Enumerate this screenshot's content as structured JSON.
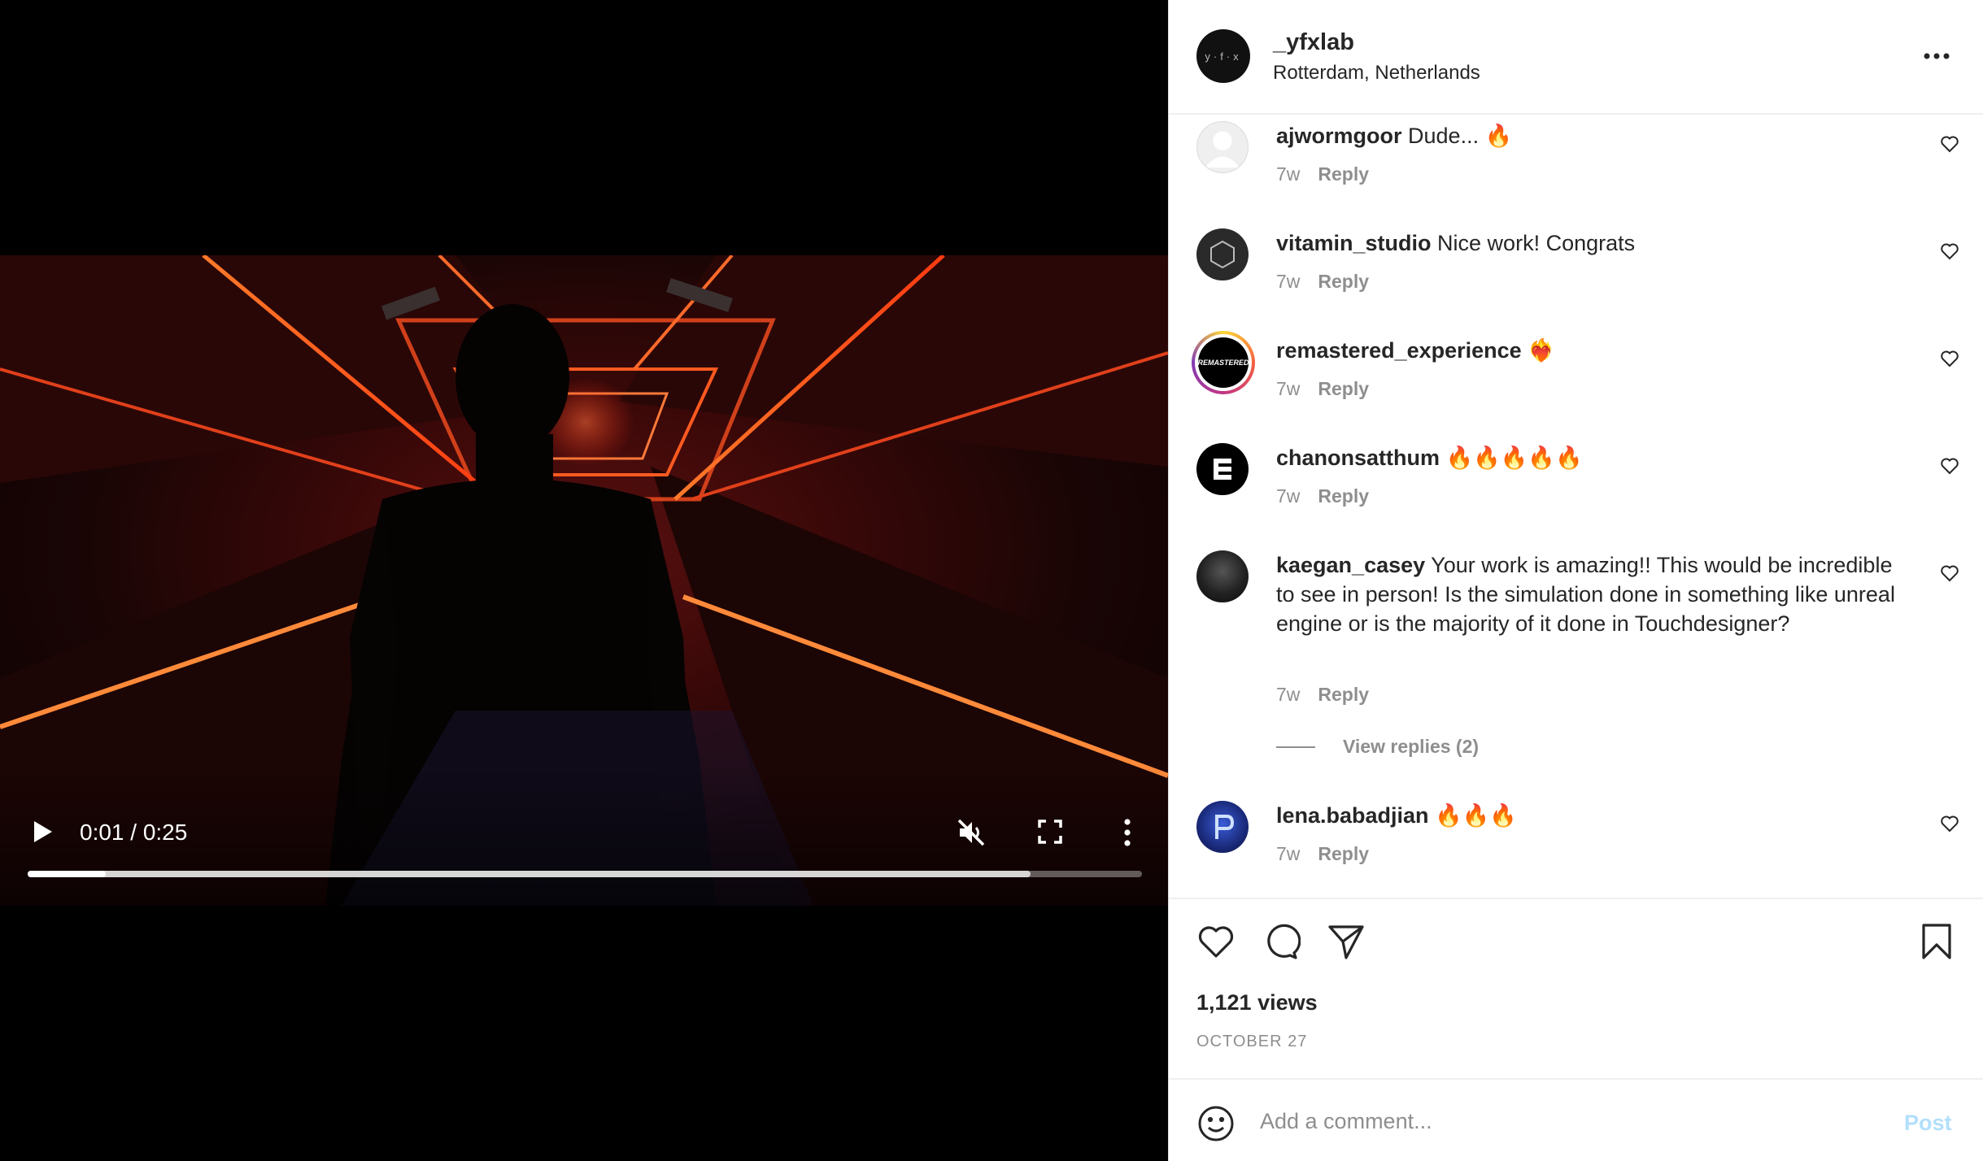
{
  "video": {
    "time": "0:01 / 0:25",
    "progress_played": 0.07,
    "progress_buffered": 0.9,
    "icons": {
      "play": "play-icon",
      "mute": "muted-speaker-icon",
      "fullscreen": "fullscreen-icon",
      "more": "vertical-ellipsis-icon"
    }
  },
  "post": {
    "owner_username": "_yfxlab",
    "owner_avatar_text": "y·f·x",
    "location": "Rotterdam, Netherlands",
    "views": "1,121 views",
    "date": "OCTOBER 27"
  },
  "comments": [
    {
      "user": "ajwormgoor",
      "text": "Dude... 🔥",
      "age": "7w",
      "reply": "Reply",
      "avatar": "default-avatar-icon"
    },
    {
      "user": "vitamin_studio",
      "text": "Nice work! Congrats",
      "age": "7w",
      "reply": "Reply",
      "avatar": "hexagon-logo"
    },
    {
      "user": "remastered_experience",
      "text": "❤️‍🔥",
      "age": "7w",
      "reply": "Reply",
      "avatar_text": "REMASTERED"
    },
    {
      "user": "chanonsatthum",
      "text": "🔥🔥🔥🔥🔥",
      "age": "7w",
      "reply": "Reply",
      "avatar": "e-logo"
    },
    {
      "user": "kaegan_casey",
      "text": "Your work is amazing!! This would be incredible to see in person! Is the simulation done in something like unreal engine or is the majority of it done in Touchdesigner?",
      "age": "7w",
      "reply": "Reply",
      "avatar": "portrait-photo"
    },
    {
      "user": "lena.babadjian",
      "text": "🔥🔥🔥",
      "age": "7w",
      "reply": "Reply",
      "avatar": "blue-p-logo"
    }
  ],
  "view_replies": "View replies (2)",
  "add_comment": {
    "placeholder": "Add a comment...",
    "post_label": "Post"
  },
  "colors": {
    "accent_disabled": "#b2dffc",
    "muted_text": "#8e8e8e",
    "text": "#262626",
    "divider": "#efefef"
  }
}
